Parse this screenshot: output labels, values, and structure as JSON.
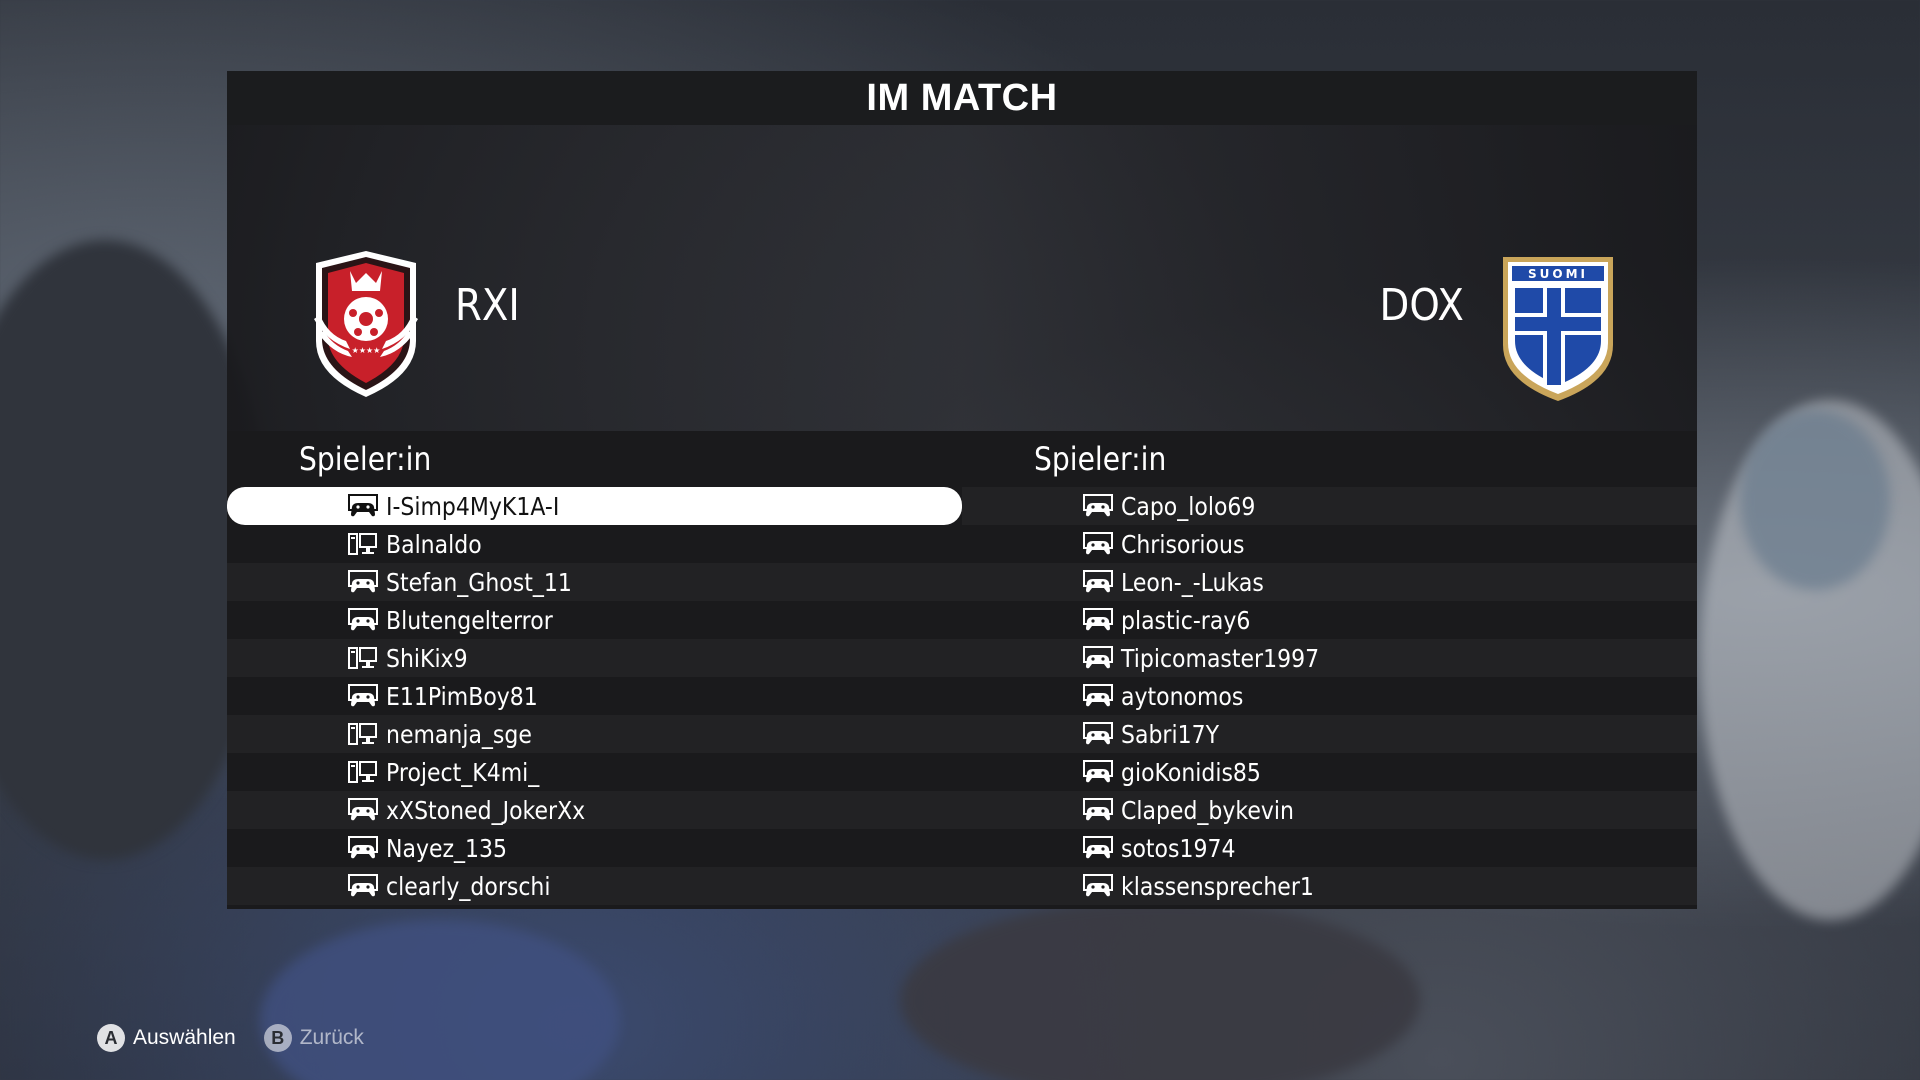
{
  "screen": {
    "title": "IM MATCH"
  },
  "teams": {
    "home": {
      "name": "RXI",
      "crest_icon": "rxi-crest-icon"
    },
    "away": {
      "name": "DOX",
      "crest_icon": "suomi-crest-icon",
      "crest_text": "SUOMI"
    }
  },
  "players": {
    "home_header": "Spieler:in",
    "away_header": "Spieler:in",
    "home": [
      {
        "name": "I-Simp4MyK1A-I",
        "device": "controller-icon",
        "selected": true
      },
      {
        "name": "Balnaldo",
        "device": "pc-icon"
      },
      {
        "name": "Stefan_Ghost_11",
        "device": "controller-icon"
      },
      {
        "name": "Blutengelterror",
        "device": "controller-icon"
      },
      {
        "name": "ShiKix9",
        "device": "pc-icon"
      },
      {
        "name": "E11PimBoy81",
        "device": "controller-icon"
      },
      {
        "name": "nemanja_sge",
        "device": "pc-icon"
      },
      {
        "name": "Project_K4mi_",
        "device": "pc-icon"
      },
      {
        "name": "xXStoned_JokerXx",
        "device": "controller-icon"
      },
      {
        "name": "Nayez_135",
        "device": "controller-icon"
      },
      {
        "name": "clearly_dorschi",
        "device": "controller-icon"
      }
    ],
    "away": [
      {
        "name": "Capo_lolo69",
        "device": "controller-icon"
      },
      {
        "name": "Chrisorious",
        "device": "controller-icon"
      },
      {
        "name": "Leon-_-Lukas",
        "device": "controller-icon"
      },
      {
        "name": "plastic-ray6",
        "device": "controller-icon"
      },
      {
        "name": "Tipicomaster1997",
        "device": "controller-icon"
      },
      {
        "name": "aytonomos",
        "device": "controller-icon"
      },
      {
        "name": "Sabri17Y",
        "device": "controller-icon"
      },
      {
        "name": "gioKonidis85",
        "device": "controller-icon"
      },
      {
        "name": "Claped_bykevin",
        "device": "controller-icon"
      },
      {
        "name": "sotos1974",
        "device": "controller-icon"
      },
      {
        "name": "klassensprecher1",
        "device": "controller-icon"
      }
    ]
  },
  "footer": {
    "select": {
      "glyph": "A",
      "label": "Auswählen"
    },
    "back": {
      "glyph": "B",
      "label": "Zurück"
    }
  },
  "colors": {
    "panel": "#1a1a1c",
    "selected_row": "#ffffff",
    "home_crest": "#c8202a",
    "away_crest": "#1f4aa8"
  }
}
